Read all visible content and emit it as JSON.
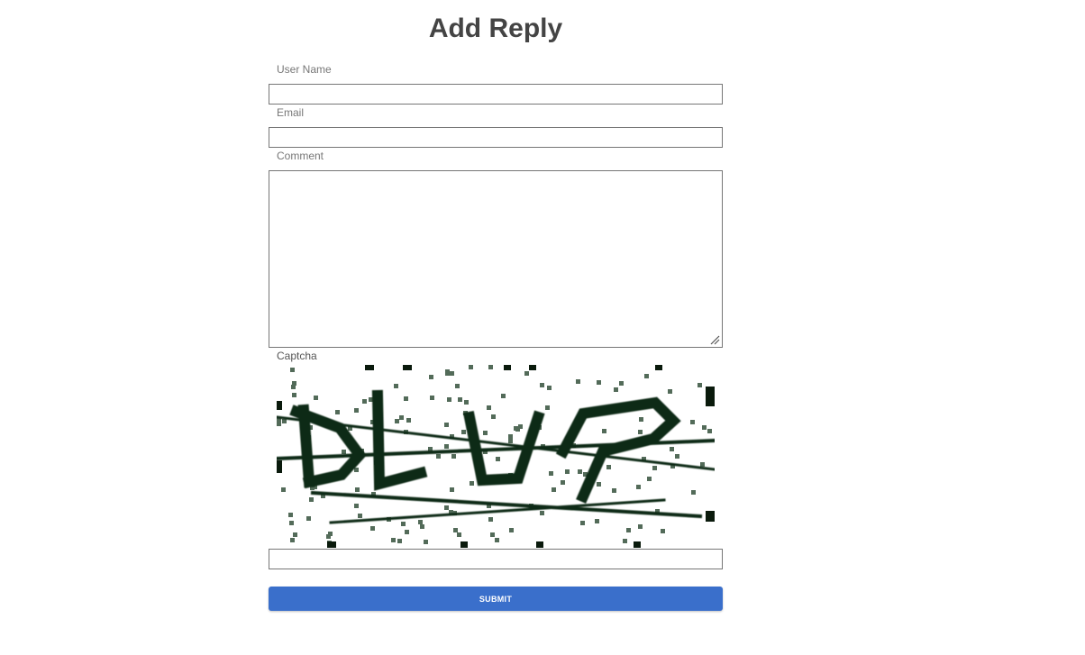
{
  "form": {
    "title": "Add Reply",
    "user_name": {
      "label": "User Name",
      "value": ""
    },
    "email": {
      "label": "Email",
      "value": ""
    },
    "comment": {
      "label": "Comment",
      "value": ""
    },
    "captcha": {
      "label": "Captcha",
      "text": "DLUP",
      "value": ""
    },
    "submit_label": "SUBMIT"
  },
  "colors": {
    "title": "#444444",
    "label": "#777777",
    "border": "#767676",
    "submit_bg": "#3a6fcb",
    "submit_text": "#ffffff",
    "captcha_ink": "#0d2a14"
  }
}
